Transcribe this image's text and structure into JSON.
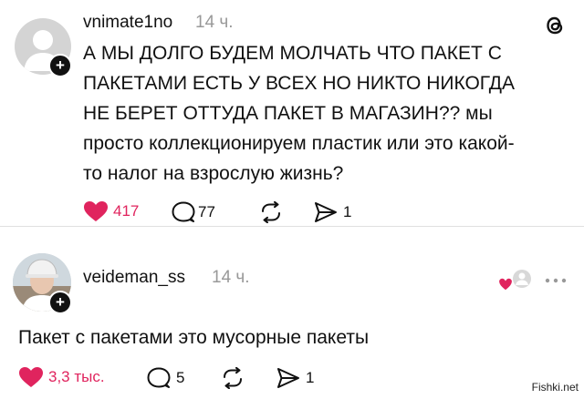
{
  "posts": [
    {
      "username": "vnimate1no",
      "time": "14 ч.",
      "text_lines": [
        "А МЫ ДОЛГО БУДЕМ МОЛЧАТЬ ЧТО ПАКЕТ С",
        "ПАКЕТАМИ ЕСТЬ У ВСЕХ НО НИКТО НИКОГДА",
        "НЕ БЕРЕТ ОТТУДА ПАКЕТ В МАГАЗИН?? мы",
        "просто коллекционируем пластик или это какой-",
        "то налог на взрослую жизнь?"
      ],
      "likes": "417",
      "replies": "77",
      "shares": "1",
      "follow_symbol": "+"
    },
    {
      "username": "veideman_ss",
      "time": "14 ч.",
      "text": "Пакет с пакетами это мусорные пакеты",
      "likes": "3,3 тыс.",
      "replies": "5",
      "shares": "1",
      "follow_symbol": "+"
    }
  ],
  "icons": {
    "app_logo": "threads-logo-icon",
    "like": "heart-icon",
    "reply": "speech-bubble-icon",
    "repost": "repost-icon",
    "share": "send-icon",
    "more": "more-dots-icon"
  },
  "watermark": "Fishki.net",
  "colors": {
    "like_red": "#e0245e",
    "muted": "#999999"
  }
}
